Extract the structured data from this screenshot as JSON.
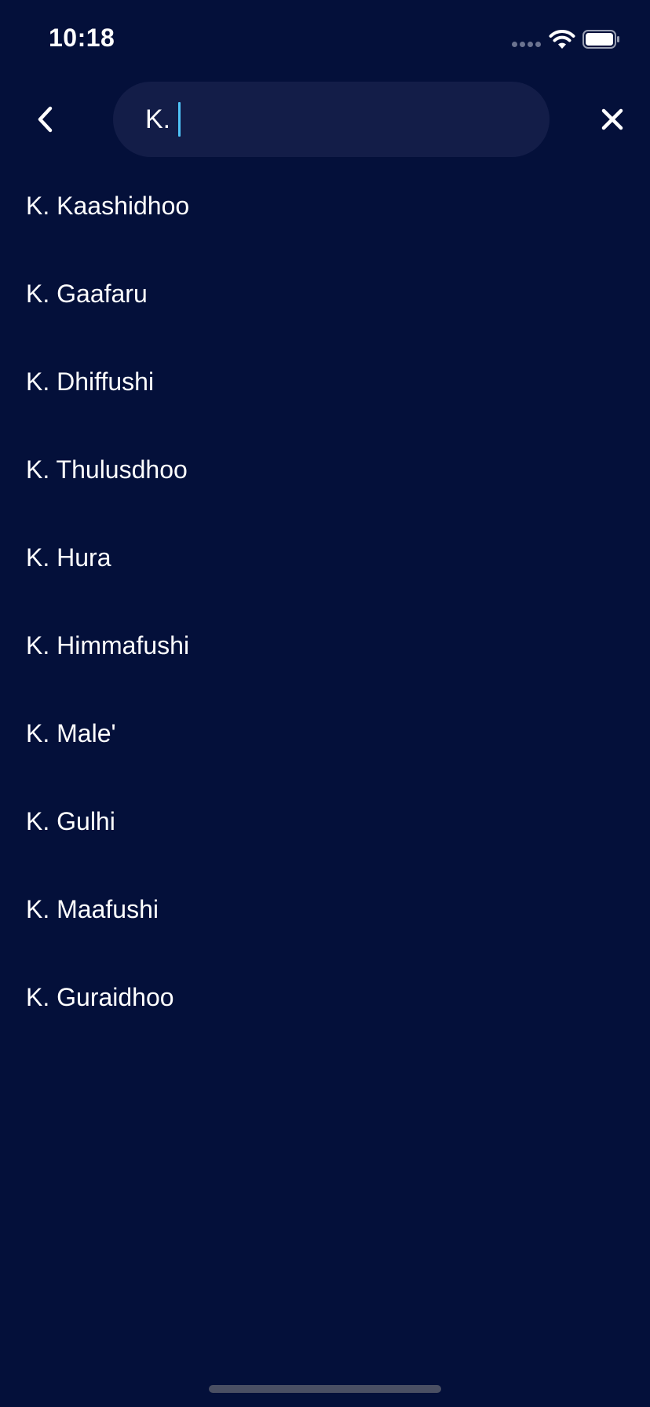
{
  "status_bar": {
    "time": "10:18"
  },
  "search": {
    "query": "K."
  },
  "results": [
    "K. Kaashidhoo",
    "K. Gaafaru",
    "K. Dhiffushi",
    "K. Thulusdhoo",
    "K. Hura",
    "K. Himmafushi",
    "K. Male'",
    "K. Gulhi",
    "K. Maafushi",
    "K. Guraidhoo"
  ],
  "colors": {
    "background": "#04103a",
    "search_field": "#131d48",
    "caret": "#4fc3f7",
    "text": "#ffffff"
  },
  "icons": {
    "back": "chevron-left-icon",
    "close": "close-icon",
    "wifi": "wifi-icon",
    "battery": "battery-icon",
    "signal": "cellular-signal-icon"
  }
}
